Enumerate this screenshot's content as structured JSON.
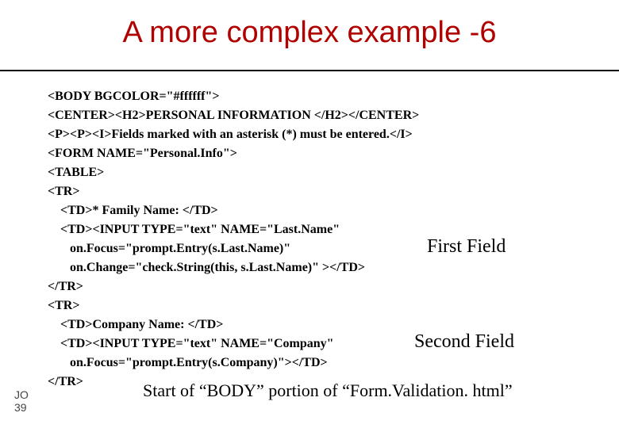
{
  "title": "A more complex example -6",
  "code_lines": [
    "<BODY BGCOLOR=\"#ffffff\">",
    "<CENTER><H2>PERSONAL INFORMATION </H2></CENTER>",
    "<P><P><I>Fields marked with an asterisk (*) must be entered.</I>",
    "<FORM NAME=\"Personal.Info\">",
    "<TABLE>",
    "<TR>",
    "    <TD>* Family Name: </TD>",
    "    <TD><INPUT TYPE=\"text\" NAME=\"Last.Name\"",
    "       on.Focus=\"prompt.Entry(s.Last.Name)\"",
    "       on.Change=\"check.String(this, s.Last.Name)\" ></TD>",
    "</TR>",
    "<TR>",
    "    <TD>Company Name: </TD>",
    "    <TD><INPUT TYPE=\"text\" NAME=\"Company\"",
    "       on.Focus=\"prompt.Entry(s.Company)\"></TD>",
    "</TR>"
  ],
  "annot_first": "First Field",
  "annot_second": "Second Field",
  "caption": "Start of “BODY” portion of  “Form.Validation. html”",
  "page_label": "JO\n39"
}
